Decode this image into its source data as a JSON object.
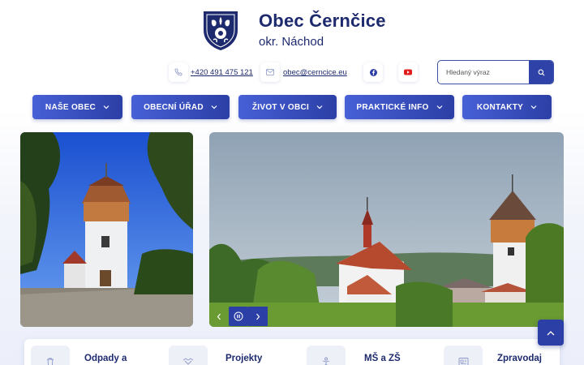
{
  "site": {
    "title": "Obec Černčice",
    "subtitle": "okr. Náchod"
  },
  "contacts": {
    "phone": "+420 491 475 121",
    "email": "obec@cerncice.eu",
    "facebook_icon": "facebook-icon",
    "youtube_icon": "youtube-icon"
  },
  "search": {
    "placeholder": "Hledaný výraz"
  },
  "nav": {
    "items": [
      {
        "label": "NAŠE OBEC"
      },
      {
        "label": "OBECNÍ ÚŘAD"
      },
      {
        "label": "ŽIVOT V OBCI"
      },
      {
        "label": "PRAKTICKÉ INFO"
      },
      {
        "label": "KONTAKTY"
      }
    ]
  },
  "quick_links": [
    {
      "label": "Odpady a",
      "icon": "trash-icon"
    },
    {
      "label": "Projekty",
      "icon": "handshake-icon"
    },
    {
      "label": "MŠ a ZŠ",
      "icon": "child-icon"
    },
    {
      "label": "Zpravodaj",
      "icon": "newspaper-icon"
    }
  ],
  "colors": {
    "primary": "#2c3fa6",
    "primary_light": "#4760d6",
    "text": "#1e2a6e",
    "youtube": "#e11d1d",
    "facebook": "#2c3fa6"
  }
}
